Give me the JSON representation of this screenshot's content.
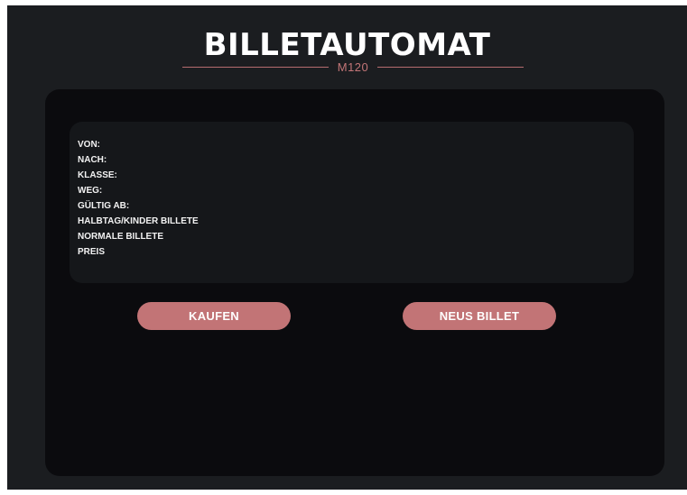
{
  "header": {
    "title": "BILLETAUTOMAT",
    "subtitle": "M120"
  },
  "ticket_info": {
    "rows": [
      {
        "label": "VON:"
      },
      {
        "label": "NACH:"
      },
      {
        "label": "KLASSE:"
      },
      {
        "label": "WEG:"
      },
      {
        "label": "GÜLTIG AB:"
      },
      {
        "label": "HALBTAG/KINDER BILLETE"
      },
      {
        "label": "NORMALE BILLETE"
      },
      {
        "label": "PREIS"
      }
    ]
  },
  "actions": {
    "buy_label": "KAUFEN",
    "new_ticket_label": "NEUS BILLET"
  },
  "colors": {
    "background": "#1b1d20",
    "panel": "#0b0b0e",
    "card": "#15171a",
    "accent": "#c27476",
    "text": "#ffffff"
  }
}
